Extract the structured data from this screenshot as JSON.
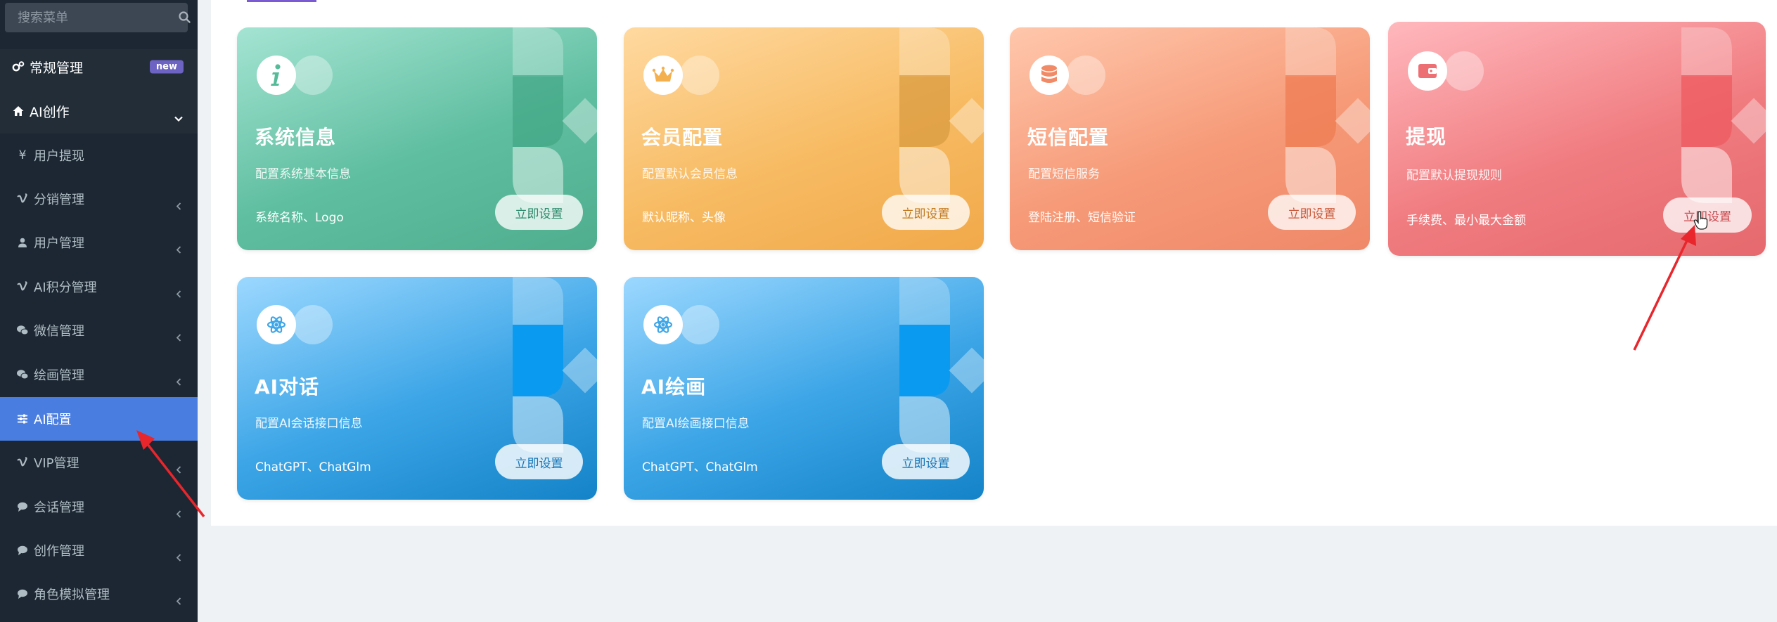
{
  "sidebar": {
    "search_placeholder": "搜索菜单",
    "top_items": [
      {
        "label": "常规管理",
        "badge": "new"
      },
      {
        "label": "AI创作"
      }
    ],
    "items": [
      {
        "label": "用户提现"
      },
      {
        "label": "分销管理"
      },
      {
        "label": "用户管理"
      },
      {
        "label": "AI积分管理"
      },
      {
        "label": "微信管理"
      },
      {
        "label": "绘画管理"
      },
      {
        "label": "AI配置",
        "active": true
      },
      {
        "label": "VIP管理"
      },
      {
        "label": "会话管理"
      },
      {
        "label": "创作管理"
      },
      {
        "label": "角色模拟管理"
      }
    ]
  },
  "cards": [
    {
      "title": "系统信息",
      "desc": "配置系统基本信息",
      "tags": "系统名称、Logo",
      "button": "立即设置",
      "icon": "info-icon",
      "color": "#5fbea0"
    },
    {
      "title": "会员配置",
      "desc": "配置默认会员信息",
      "tags": "默认昵称、头像",
      "button": "立即设置",
      "icon": "crown-icon",
      "color": "#f7bb63"
    },
    {
      "title": "短信配置",
      "desc": "配置短信服务",
      "tags": "登陆注册、短信验证",
      "button": "立即设置",
      "icon": "database-icon",
      "color": "#f69a78"
    },
    {
      "title": "提现",
      "desc": "配置默认提现规则",
      "tags": "手续费、最小最大金额",
      "button": "立即设置",
      "icon": "wallet-icon",
      "color": "#f07c80"
    },
    {
      "title": "AI对话",
      "desc": "配置AI会话接口信息",
      "tags": "ChatGPT、ChatGlm",
      "button": "立即设置",
      "icon": "atom-icon",
      "color": "#3aa4e6"
    },
    {
      "title": "AI绘画",
      "desc": "配置AI绘画接口信息",
      "tags": "ChatGPT、ChatGlm",
      "button": "立即设置",
      "icon": "atom-icon",
      "color": "#3aa4e6"
    }
  ]
}
